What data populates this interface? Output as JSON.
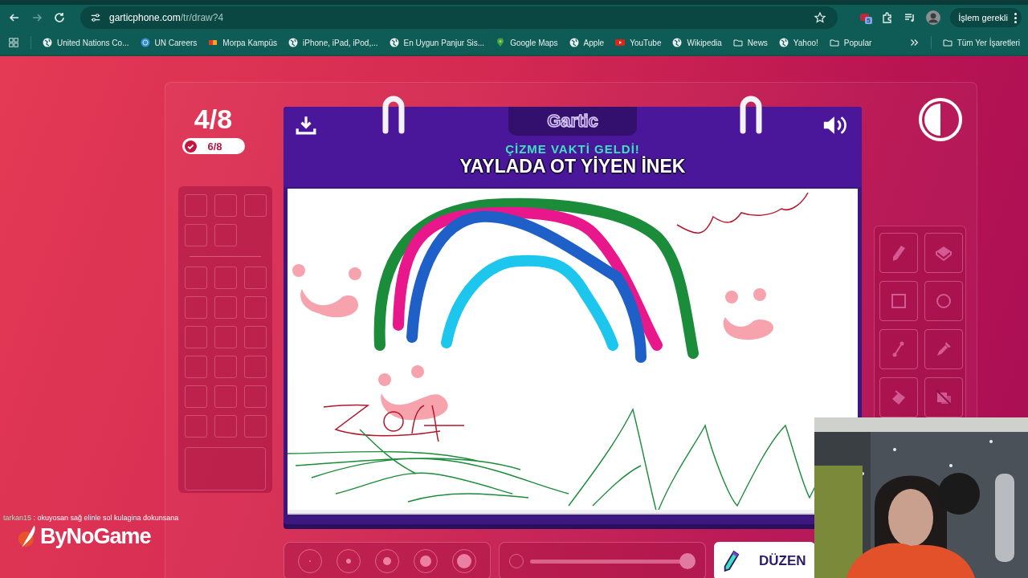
{
  "browser": {
    "url_host": "garticphone.com",
    "url_path": "/tr/draw?4",
    "extension_badge": "5",
    "account_label": "İşlem gerekli",
    "bookmarks": [
      {
        "label": "United Nations Co...",
        "kind": "globe"
      },
      {
        "label": "UN Careers",
        "kind": "un"
      },
      {
        "label": "Morpa Kampüs",
        "kind": "morpa"
      },
      {
        "label": "iPhone, iPad, iPod,...",
        "kind": "globe"
      },
      {
        "label": "En Uygun Panjur Sis...",
        "kind": "globe"
      },
      {
        "label": "Google Maps",
        "kind": "maps"
      },
      {
        "label": "Apple",
        "kind": "globe"
      },
      {
        "label": "YouTube",
        "kind": "youtube"
      },
      {
        "label": "Wikipedia",
        "kind": "globe"
      },
      {
        "label": "News",
        "kind": "folder"
      },
      {
        "label": "Yahoo!",
        "kind": "globe"
      },
      {
        "label": "Popular",
        "kind": "folder"
      }
    ],
    "all_bookmarks": "Tüm Yer İşaretleri"
  },
  "game": {
    "round": "4/8",
    "done": "6/8",
    "logo": "Gartic",
    "subtitle": "ÇİZME VAKTİ GELDİ!",
    "theme": "YAYLADA OT YİYEN İNEK",
    "edit_button": "DÜZEN",
    "opacity": {
      "level": 1
    }
  },
  "stream": {
    "chat_user": "tarkan15",
    "chat_message": ": okuyosan sağ elinle sol kulagina dokunsana",
    "brand": "ByNoGame"
  }
}
